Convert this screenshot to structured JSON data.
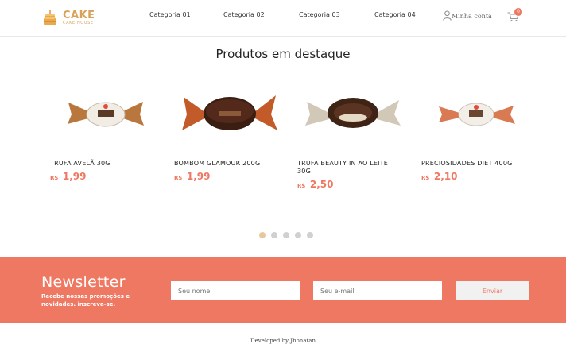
{
  "header": {
    "logo_text": "CAKE",
    "logo_sub": "CAKE HOUSE",
    "nav": [
      "Categoria 01",
      "Categoria 02",
      "Categoria 03",
      "Categoria 04"
    ],
    "account_label": "Minha conta",
    "cart_count": "0"
  },
  "section_title": "Produtos em destaque",
  "products": [
    {
      "name": "TRUFA AVELÃ 30G",
      "currency": "R$",
      "price": "1,99"
    },
    {
      "name": "BOMBOM GLAMOUR 200G",
      "currency": "R$",
      "price": "1,99"
    },
    {
      "name": "TRUFA BEAUTY IN AO LEITE 30G",
      "currency": "R$",
      "price": "2,50"
    },
    {
      "name": "PRECIOSIDADES DIET 400G",
      "currency": "R$",
      "price": "2,10"
    }
  ],
  "carousel": {
    "pages": 5,
    "active": 1
  },
  "newsletter": {
    "title": "Newsletter",
    "subtitle": "Recebe nossas promoções e novidades. inscreva-se.",
    "name_placeholder": "Seu nome",
    "email_placeholder": "Seu e-mail",
    "submit_label": "Enviar"
  },
  "footer": "Developed by Jhonatan",
  "colors": {
    "accent": "#ef7862",
    "gold": "#d8a25a"
  },
  "icons": {
    "account": "user-icon",
    "cart": "cart-icon"
  }
}
